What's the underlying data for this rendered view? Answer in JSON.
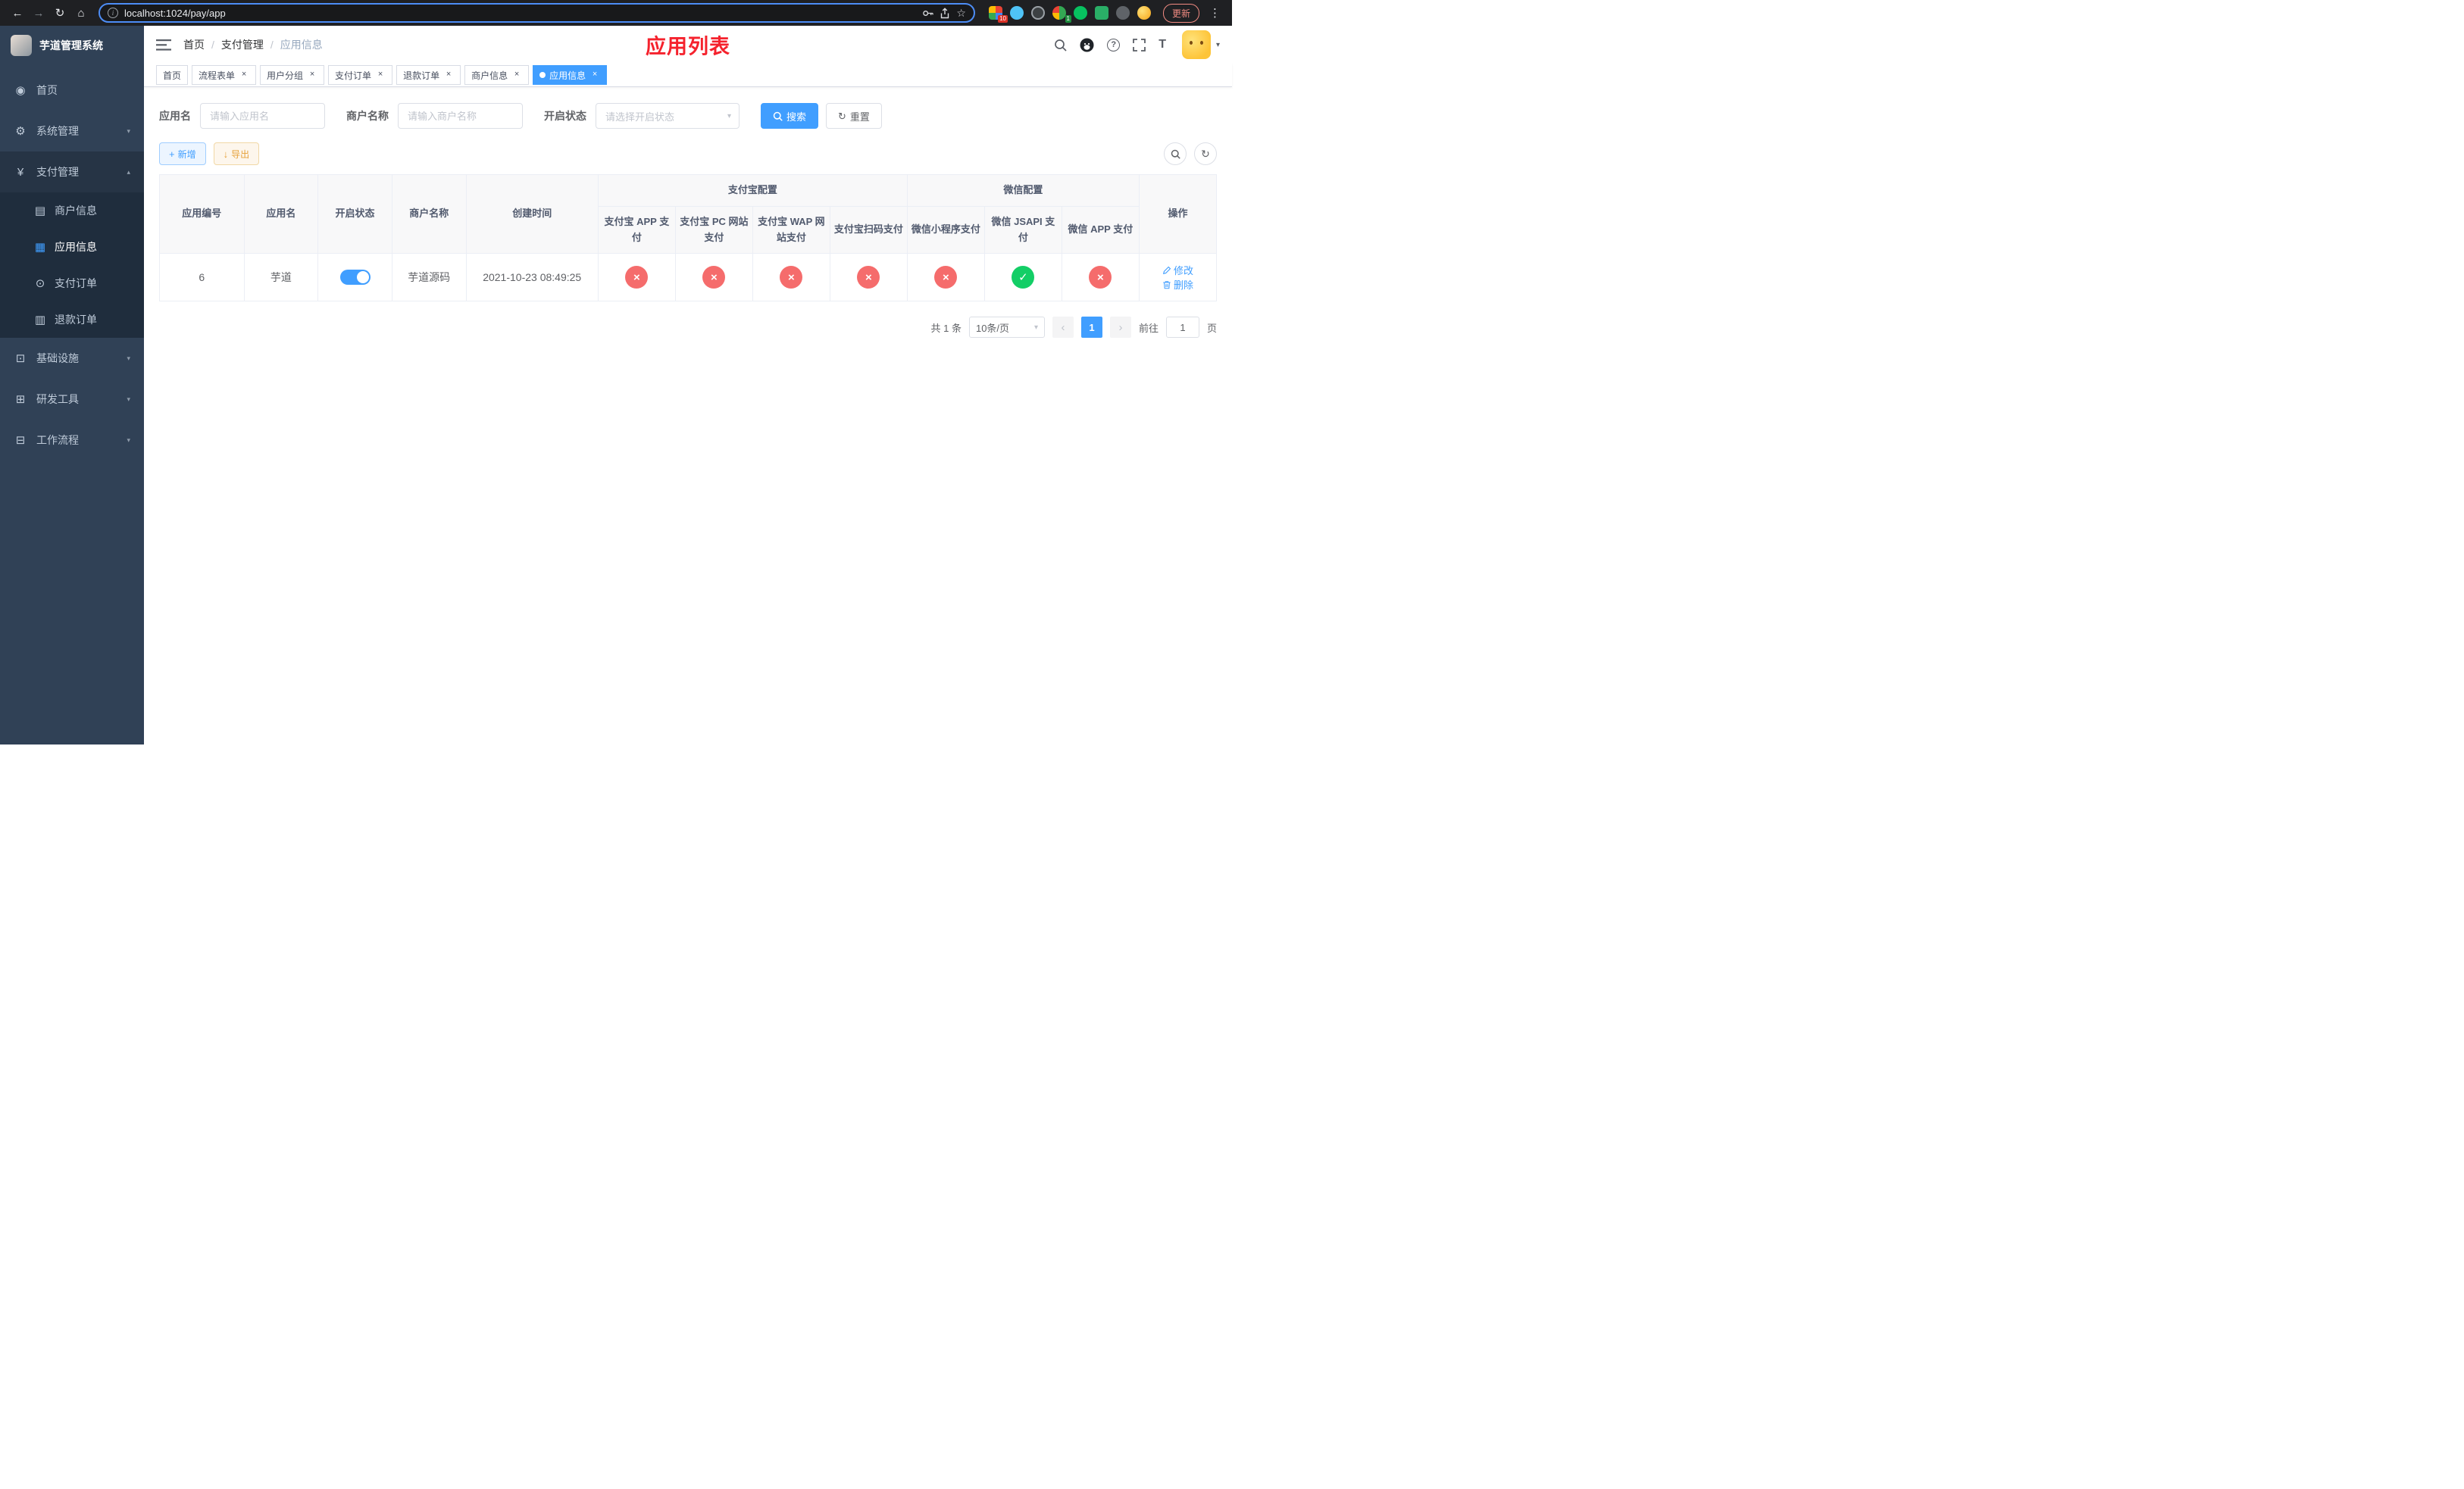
{
  "colors": {
    "primary": "#409eff",
    "success": "#13ce66",
    "danger": "#f56c6c",
    "warning": "#e6a23c",
    "title_red": "#f5222d",
    "sidebar_bg": "#304156",
    "submenu_bg": "#1f2d3d"
  },
  "icons": {
    "back": "←",
    "forward": "→",
    "reload": "↻",
    "home": "⌂",
    "info": "i",
    "star": "☆",
    "kebab": "⋮",
    "dashboard": "◉",
    "gear": "⚙",
    "yen": "¥",
    "merchant": "▤",
    "app": "▦",
    "pay_order": "⊙",
    "refund_order": "▥",
    "infra": "⊡",
    "devtools": "⊞",
    "workflow": "⊟",
    "chevron_down": "▾",
    "chevron_up": "▴",
    "caret_down": "▾",
    "question": "?",
    "plus": "+",
    "download": "↓",
    "refresh": "↻",
    "prev": "‹",
    "next": "›",
    "close": "×",
    "check": "✓",
    "cross": "×",
    "tsize": "T"
  },
  "browser": {
    "url": "localhost:1024/pay/app",
    "update_label": "更新",
    "ext_badge_red": "10",
    "ext_badge_green": "1"
  },
  "sidebar": {
    "logo_title": "芋道管理系统",
    "menu": [
      {
        "label": "首页"
      },
      {
        "label": "系统管理"
      },
      {
        "label": "支付管理"
      },
      {
        "label": "基础设施"
      },
      {
        "label": "研发工具"
      },
      {
        "label": "工作流程"
      }
    ],
    "payment_submenu": [
      {
        "label": "商户信息"
      },
      {
        "label": "应用信息"
      },
      {
        "label": "支付订单"
      },
      {
        "label": "退款订单"
      }
    ]
  },
  "header": {
    "breadcrumb": [
      "首页",
      "支付管理",
      "应用信息"
    ],
    "title": "应用列表"
  },
  "tags": [
    {
      "label": "首页"
    },
    {
      "label": "流程表单"
    },
    {
      "label": "用户分组"
    },
    {
      "label": "支付订单"
    },
    {
      "label": "退款订单"
    },
    {
      "label": "商户信息"
    },
    {
      "label": "应用信息"
    }
  ],
  "search": {
    "app_name_label": "应用名",
    "app_name_placeholder": "请输入应用名",
    "merchant_label": "商户名称",
    "merchant_placeholder": "请输入商户名称",
    "status_label": "开启状态",
    "status_placeholder": "请选择开启状态",
    "search_button": "搜索",
    "reset_button": "重置"
  },
  "toolbar": {
    "add_button": "新增",
    "export_button": "导出"
  },
  "table": {
    "groups": {
      "alipay": "支付宝配置",
      "wechat": "微信配置"
    },
    "columns": [
      "应用编号",
      "应用名",
      "开启状态",
      "商户名称",
      "创建时间",
      "支付宝 APP 支付",
      "支付宝 PC 网站支付",
      "支付宝 WAP 网站支付",
      "支付宝扫码支付",
      "微信小程序支付",
      "微信 JSAPI 支付",
      "微信 APP 支付",
      "操作"
    ],
    "row": {
      "id": "6",
      "name": "芋道",
      "status_on": true,
      "merchant": "芋道源码",
      "created": "2021-10-23 08:49:25",
      "configs": [
        "no",
        "no",
        "no",
        "no",
        "no",
        "yes",
        "no"
      ],
      "edit_label": "修改",
      "delete_label": "删除"
    }
  },
  "pagination": {
    "total": "共 1 条",
    "page_size": "10条/页",
    "current_page": "1",
    "goto_label": "前往",
    "goto_value": "1",
    "page_unit": "页"
  }
}
